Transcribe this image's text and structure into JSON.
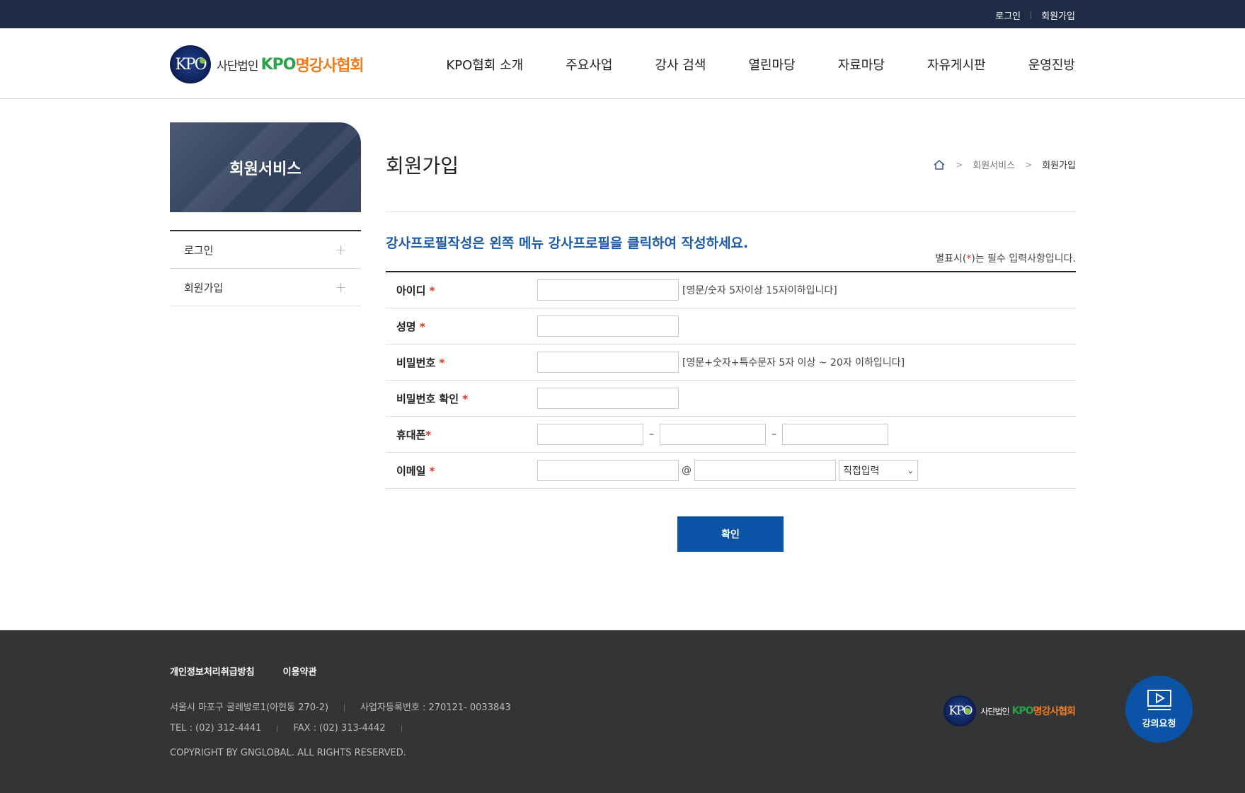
{
  "topbar": {
    "login": "로그인",
    "join": "회원가입"
  },
  "logo": {
    "mark": "KPO",
    "sub": "사단법인",
    "kpo": "KPO",
    "name": "명강사협회"
  },
  "gnb": [
    "KPO협회 소개",
    "주요사업",
    "강사 검색",
    "열린마당",
    "자료마당",
    "자유게시판",
    "운영진방"
  ],
  "lnb": {
    "title": "회원서비스",
    "items": [
      {
        "label": "로그인"
      },
      {
        "label": "회원가입"
      }
    ]
  },
  "page": {
    "title": "회원가입",
    "breadcrumb": [
      "회원서비스",
      "회원가입"
    ],
    "notice": "강사프로필작성은 왼쪽 메뉴 강사프로필을 클릭하여 작성하세요.",
    "required_note_pre": "별표시(",
    "required_note_star": "*",
    "required_note_post": ")는 필수 입력사항입니다."
  },
  "form": {
    "id_label": "아이디 ",
    "id_hint": "[영문/숫자 5자이상 15자이하입니다]",
    "name_label": "성명 ",
    "pw_label": "비밀번호 ",
    "pw_hint": "[영문+숫자+특수문자 5자 이상 ~ 20자 이하입니다]",
    "pw_confirm_label": "비밀번호 확인 ",
    "phone_label": "휴대폰",
    "phone_sep": "–",
    "email_label": "이메일 ",
    "email_at": "@",
    "email_domain_select": "직접입력",
    "star": "*",
    "submit": "확인"
  },
  "footer": {
    "links": [
      "개인정보처리취급방침",
      "이용약관"
    ],
    "address": "서울시 마포구 굴레방로1(아현동 270-2)",
    "business_no": "사업자등록번호 : 270121- 0033843",
    "tel": "TEL : (02) 312-4441",
    "fax": "FAX : (02) 313-4442",
    "copyright": "COPYRIGHT BY GNGLOBAL. ALL RIGHTS RESERVED."
  },
  "float_button": {
    "label": "강의요청"
  }
}
